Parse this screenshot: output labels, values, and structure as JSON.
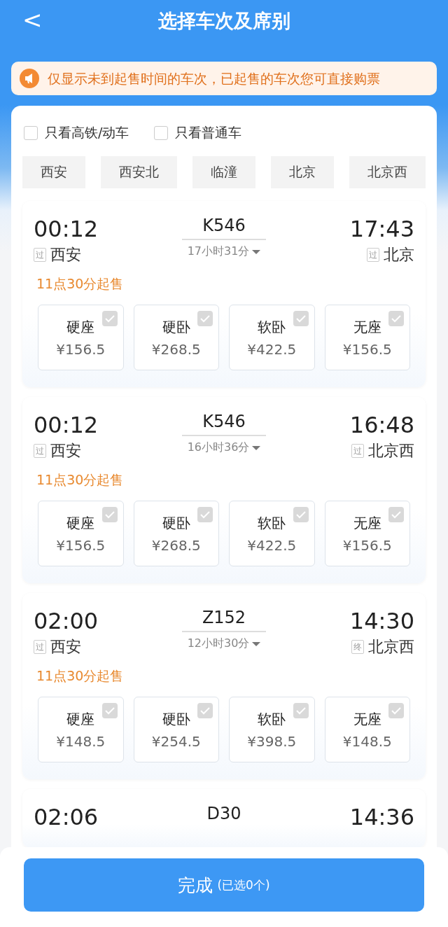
{
  "header": {
    "back": "<",
    "title": "选择车次及席别"
  },
  "notice": {
    "text": "仅显示未到起售时间的车次，已起售的车次您可直接购票"
  },
  "filters": [
    {
      "label": "只看高铁/动车",
      "checked": false
    },
    {
      "label": "只看普通车",
      "checked": false
    }
  ],
  "stations": [
    {
      "label": "西安",
      "selected": false
    },
    {
      "label": "西安北",
      "selected": false
    },
    {
      "label": "临潼",
      "selected": false
    },
    {
      "label": "北京",
      "selected": false
    },
    {
      "label": "北京西",
      "selected": false
    }
  ],
  "trains": [
    {
      "depart_time": "00:12",
      "depart_tag": "过",
      "depart_station": "西安",
      "train_no": "K546",
      "duration": "17小时31分",
      "arrive_time": "17:43",
      "arrive_tag": "过",
      "arrive_station": "北京",
      "sale_time": "11点30分起售",
      "seats": [
        {
          "name": "硬座",
          "price": "¥156.5",
          "checked": false
        },
        {
          "name": "硬卧",
          "price": "¥268.5",
          "checked": false
        },
        {
          "name": "软卧",
          "price": "¥422.5",
          "checked": false
        },
        {
          "name": "无座",
          "price": "¥156.5",
          "checked": false
        }
      ]
    },
    {
      "depart_time": "00:12",
      "depart_tag": "过",
      "depart_station": "西安",
      "train_no": "K546",
      "duration": "16小时36分",
      "arrive_time": "16:48",
      "arrive_tag": "过",
      "arrive_station": "北京西",
      "sale_time": "11点30分起售",
      "seats": [
        {
          "name": "硬座",
          "price": "¥156.5",
          "checked": false
        },
        {
          "name": "硬卧",
          "price": "¥268.5",
          "checked": false
        },
        {
          "name": "软卧",
          "price": "¥422.5",
          "checked": false
        },
        {
          "name": "无座",
          "price": "¥156.5",
          "checked": false
        }
      ]
    },
    {
      "depart_time": "02:00",
      "depart_tag": "过",
      "depart_station": "西安",
      "train_no": "Z152",
      "duration": "12小时30分",
      "arrive_time": "14:30",
      "arrive_tag": "终",
      "arrive_station": "北京西",
      "sale_time": "11点30分起售",
      "seats": [
        {
          "name": "硬座",
          "price": "¥148.5",
          "checked": false
        },
        {
          "name": "硬卧",
          "price": "¥254.5",
          "checked": false
        },
        {
          "name": "软卧",
          "price": "¥398.5",
          "checked": false
        },
        {
          "name": "无座",
          "price": "¥148.5",
          "checked": false
        }
      ]
    },
    {
      "depart_time": "02:06",
      "train_no": "D30",
      "arrive_time": "14:36"
    }
  ],
  "footer": {
    "button": "完成",
    "selected_count": "(已选0个)"
  }
}
